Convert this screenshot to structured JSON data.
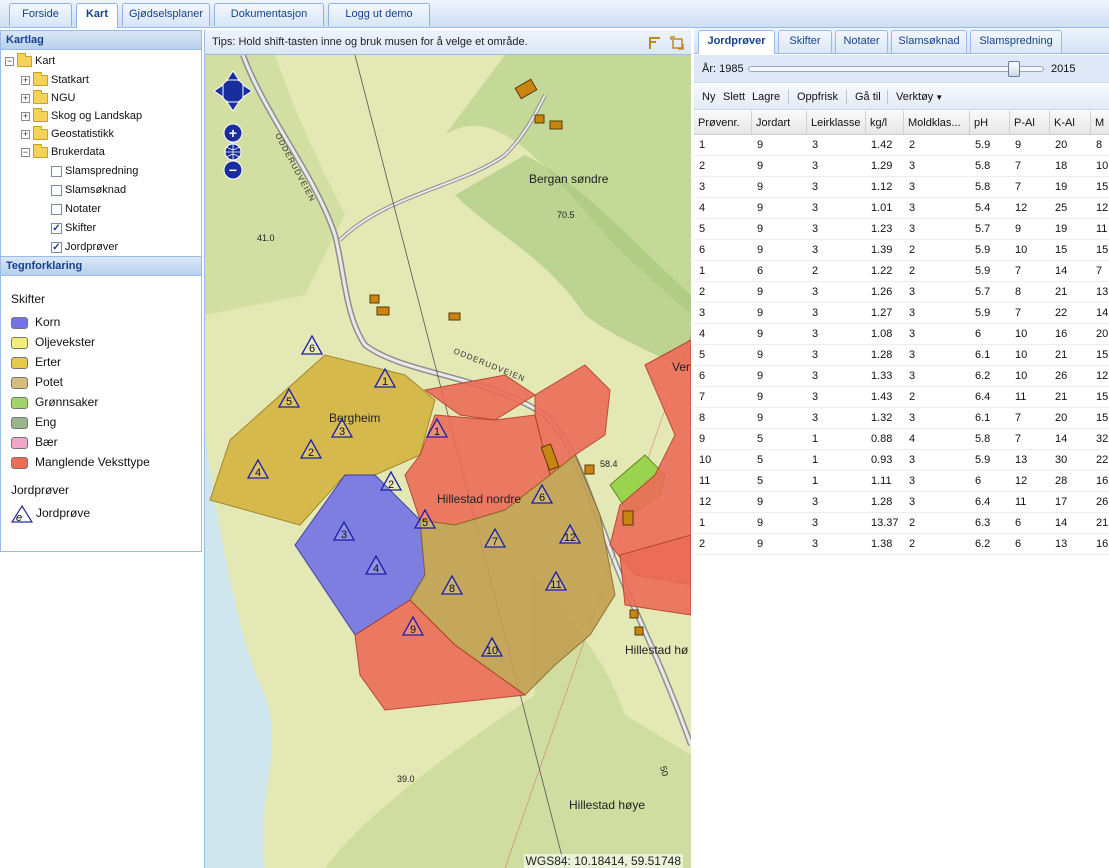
{
  "top_tabs": [
    "Forside",
    "Kart",
    "Gjødselsplaner",
    "Dokumentasjon",
    "Logg ut demo"
  ],
  "kartlag": {
    "title": "Kartlag",
    "root": "Kart",
    "folders": [
      "Statkart",
      "NGU",
      "Skog og Landskap",
      "Geostatistikk",
      "Brukerdata"
    ],
    "layers": [
      {
        "label": "Slamspredning",
        "checked": false
      },
      {
        "label": "Slamsøknad",
        "checked": false
      },
      {
        "label": "Notater",
        "checked": false
      },
      {
        "label": "Skifter",
        "checked": true
      },
      {
        "label": "Jordprøver",
        "checked": true
      }
    ]
  },
  "legend": {
    "title": "Tegnforklaring",
    "skifter_heading": "Skifter",
    "items": [
      {
        "label": "Korn",
        "color": "#7373e6"
      },
      {
        "label": "Oljevekster",
        "color": "#f3ee7a"
      },
      {
        "label": "Erter",
        "color": "#e8c84a"
      },
      {
        "label": "Potet",
        "color": "#d6bd7c"
      },
      {
        "label": "Grønnsaker",
        "color": "#a3d46a"
      },
      {
        "label": "Eng",
        "color": "#9ab58d"
      },
      {
        "label": "Bær",
        "color": "#f0a6c8"
      },
      {
        "label": "Manglende Veksttype",
        "color": "#ec6c57"
      }
    ],
    "jordprover_heading": "Jordprøver",
    "jordprove_label": "Jordprøve",
    "jordprove_symbol": "e"
  },
  "map": {
    "tips": "Tips: Hold shift-tasten inne og bruk musen for å velge et område.",
    "coordinates": "WGS84: 10.18414, 59.51748",
    "zoom_in": "+",
    "zoom_out": "−",
    "place_labels": [
      "Bergan søndre",
      "Bergheim",
      "Hillestad nordre",
      "Hillestad høye",
      "Hillestad hø",
      "Ver"
    ],
    "road_label": "ODDERUDVEIEN",
    "road_label_2": "ODDERUDVEIEN",
    "elevations": [
      "41.0",
      "70.5",
      "58.4",
      "39.0",
      "50"
    ],
    "sample_numbers": [
      "1",
      "2",
      "3",
      "4",
      "5",
      "6",
      "1",
      "2",
      "3",
      "4",
      "5",
      "6",
      "7",
      "8",
      "9",
      "10",
      "11",
      "12"
    ]
  },
  "right_tabs": [
    "Jordprøver",
    "Skifter",
    "Notater",
    "Slamsøknad",
    "Slamspredning"
  ],
  "year_slider": {
    "label": "År: 1985",
    "end": "2015",
    "value": 2012,
    "min": 1985,
    "max": 2015
  },
  "toolbar": [
    "Ny",
    "Slett",
    "Lagre",
    "Oppfrisk",
    "Gå til",
    "Verktøy"
  ],
  "table": {
    "headers": [
      "Prøvenr.",
      "Jordart",
      "Leirklasse",
      "kg/l",
      "Moldklas...",
      "pH",
      "P-Al",
      "K-Al",
      "M"
    ],
    "rows": [
      [
        "1",
        "9",
        "3",
        "1.42",
        "2",
        "5.9",
        "9",
        "20",
        "8"
      ],
      [
        "2",
        "9",
        "3",
        "1.29",
        "3",
        "5.8",
        "7",
        "18",
        "10"
      ],
      [
        "3",
        "9",
        "3",
        "1.12",
        "3",
        "5.8",
        "7",
        "19",
        "15"
      ],
      [
        "4",
        "9",
        "3",
        "1.01",
        "3",
        "5.4",
        "12",
        "25",
        "12"
      ],
      [
        "5",
        "9",
        "3",
        "1.23",
        "3",
        "5.7",
        "9",
        "19",
        "11"
      ],
      [
        "6",
        "9",
        "3",
        "1.39",
        "2",
        "5.9",
        "10",
        "15",
        "15"
      ],
      [
        "1",
        "6",
        "2",
        "1.22",
        "2",
        "5.9",
        "7",
        "14",
        "7"
      ],
      [
        "2",
        "9",
        "3",
        "1.26",
        "3",
        "5.7",
        "8",
        "21",
        "13"
      ],
      [
        "3",
        "9",
        "3",
        "1.27",
        "3",
        "5.9",
        "7",
        "22",
        "14"
      ],
      [
        "4",
        "9",
        "3",
        "1.08",
        "3",
        "6",
        "10",
        "16",
        "20"
      ],
      [
        "5",
        "9",
        "3",
        "1.28",
        "3",
        "6.1",
        "10",
        "21",
        "15"
      ],
      [
        "6",
        "9",
        "3",
        "1.33",
        "3",
        "6.2",
        "10",
        "26",
        "12"
      ],
      [
        "7",
        "9",
        "3",
        "1.43",
        "2",
        "6.4",
        "11",
        "21",
        "15"
      ],
      [
        "8",
        "9",
        "3",
        "1.32",
        "3",
        "6.1",
        "7",
        "20",
        "15"
      ],
      [
        "9",
        "5",
        "1",
        "0.88",
        "4",
        "5.8",
        "7",
        "14",
        "32"
      ],
      [
        "10",
        "5",
        "1",
        "0.93",
        "3",
        "5.9",
        "13",
        "30",
        "22"
      ],
      [
        "11",
        "5",
        "1",
        "1.11",
        "3",
        "6",
        "12",
        "28",
        "16"
      ],
      [
        "12",
        "9",
        "3",
        "1.28",
        "3",
        "6.4",
        "11",
        "17",
        "26"
      ],
      [
        "1",
        "9",
        "3",
        "13.37",
        "2",
        "6.3",
        "6",
        "14",
        "21"
      ],
      [
        "2",
        "9",
        "3",
        "1.38",
        "2",
        "6.2",
        "6",
        "13",
        "16"
      ]
    ]
  }
}
